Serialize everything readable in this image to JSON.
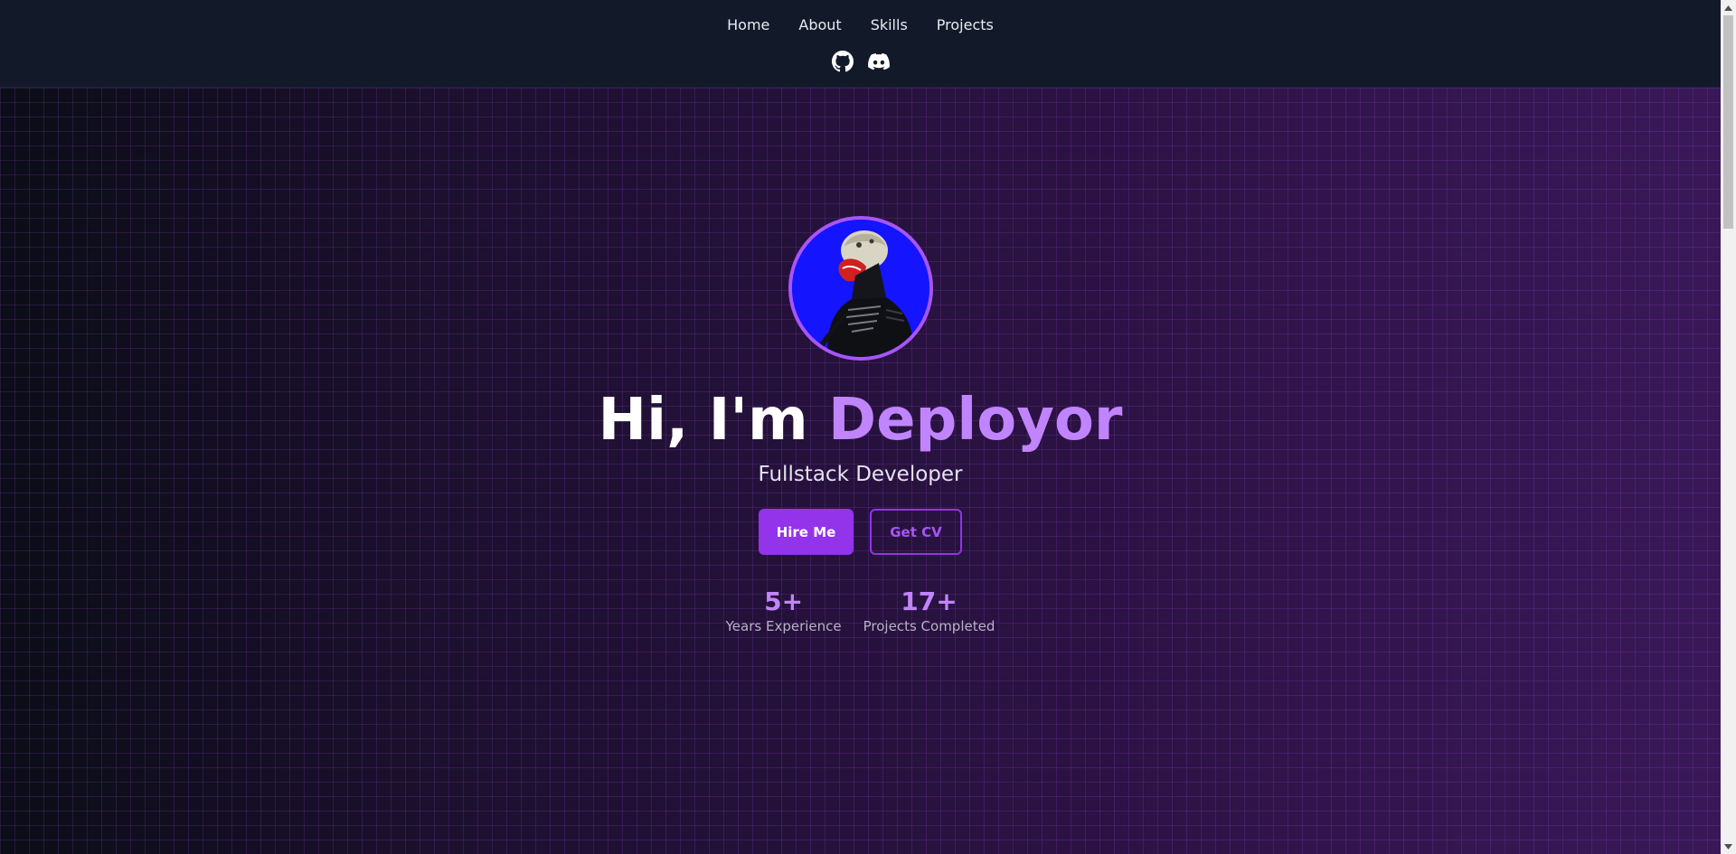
{
  "nav": {
    "items": [
      {
        "label": "Home"
      },
      {
        "label": "About"
      },
      {
        "label": "Skills"
      },
      {
        "label": "Projects"
      }
    ]
  },
  "social": {
    "icons": [
      "github-icon",
      "discord-icon"
    ]
  },
  "hero": {
    "greeting": "Hi, I'm ",
    "name": "Deployor",
    "subtitle": "Fullstack Developer",
    "primary_button": "Hire Me",
    "secondary_button": "Get CV",
    "stats": [
      {
        "value": "5+",
        "label": "Years Experience"
      },
      {
        "value": "17+",
        "label": "Projects Completed"
      }
    ]
  },
  "colors": {
    "accent": "#a855f7",
    "accent_button": "#9333ea",
    "accent_text": "#c084fc",
    "header_bg": "#121a2a"
  }
}
